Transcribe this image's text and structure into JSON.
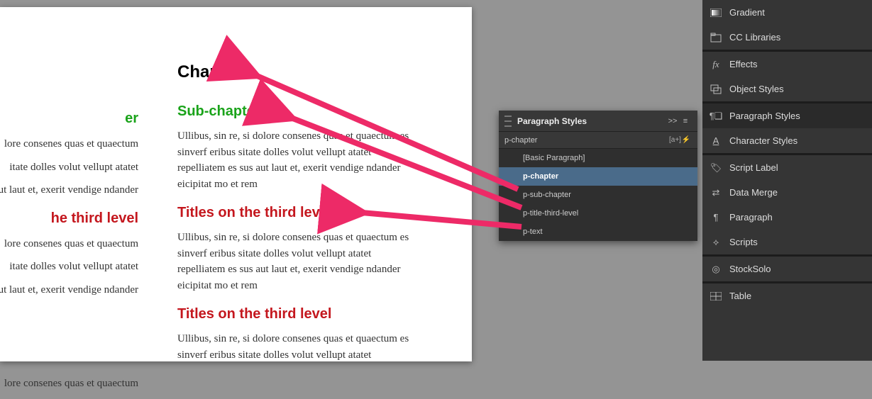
{
  "document": {
    "chapter": "Chapter",
    "subChapter": "Sub-chapter",
    "thirdLevel": "Titles on the third level",
    "bodyA": "Ullibus, sin re, si dolore consenes quas et quaectum es sinverf eribus sitate dolles volut vellupt atatet repelliatem es sus aut laut et, exerit vendige ndander eicipitat mo et rem",
    "bodyB": "Ullibus, sin re, si dolore consenes quas et quaectum es sinverf eribus sitate dolles volut vellupt atatet",
    "leftFragGreen": "er",
    "leftFragRed": "he third level",
    "leftBody1": "lore consenes quas et quaectum",
    "leftBody2": "itate dolles volut vellupt atatet",
    "leftBody3": "ut laut et, exerit vendige ndander"
  },
  "psPanel": {
    "title": "Paragraph Styles",
    "currentStyle": "p-chapter",
    "items": [
      {
        "label": "[Basic Paragraph]",
        "selected": false
      },
      {
        "label": "p-chapter",
        "selected": true
      },
      {
        "label": "p-sub-chapter",
        "selected": false
      },
      {
        "label": "p-title-third-level",
        "selected": false
      },
      {
        "label": "p-text",
        "selected": false
      }
    ]
  },
  "dock": {
    "items": [
      {
        "label": "Gradient",
        "icon": "gradient"
      },
      {
        "label": "CC Libraries",
        "icon": "libraries"
      }
    ],
    "group2": [
      {
        "label": "Effects",
        "icon": "fx"
      },
      {
        "label": "Object Styles",
        "icon": "object-styles"
      }
    ],
    "group3": [
      {
        "label": "Paragraph Styles",
        "icon": "para-styles",
        "active": true
      },
      {
        "label": "Character Styles",
        "icon": "char-styles"
      }
    ],
    "group4": [
      {
        "label": "Script Label",
        "icon": "script-label"
      },
      {
        "label": "Data Merge",
        "icon": "data-merge"
      },
      {
        "label": "Paragraph",
        "icon": "paragraph"
      },
      {
        "label": "Scripts",
        "icon": "scripts"
      }
    ],
    "group5": [
      {
        "label": "StockSolo",
        "icon": "stocksolo"
      }
    ],
    "group6": [
      {
        "label": "Table",
        "icon": "table"
      }
    ]
  }
}
